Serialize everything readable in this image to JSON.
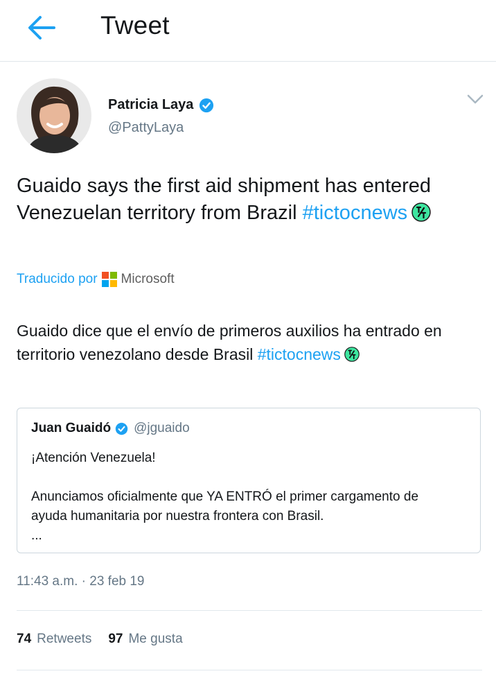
{
  "header": {
    "back_icon": "arrow-left-icon",
    "title": "Tweet"
  },
  "colors": {
    "accent": "#1da1f2",
    "secondary_text": "#657786",
    "primary_text": "#14171a",
    "divider": "#e1e8ed"
  },
  "tweet": {
    "author_name": "Patricia Laya",
    "author_handle": "@PattyLaya",
    "verified_icon": "verified-badge-icon",
    "menu_icon": "chevron-down-icon",
    "text": "Guaido says the first aid shipment has entered Venezuelan territory from Brazil",
    "hashtag": "#tictocnews",
    "emoji_icon": "tictoc-emoji-icon",
    "translated_by_label": "Traducido por",
    "translator_name": "Microsoft",
    "translator_icon": "microsoft-logo-icon",
    "translation_text": "Guaido dice que el envío de primeros auxilios ha entrado en territorio venezolano desde Brasil",
    "translation_hashtag": "#tictocnews",
    "timestamp": "11:43 a.m. · 23 feb 19",
    "retweets_count": "74",
    "retweets_label": "Retweets",
    "likes_count": "97",
    "likes_label": "Me gusta"
  },
  "quoted_tweet": {
    "author_name": "Juan Guaidó",
    "author_handle": "@jguaido",
    "lines": [
      "¡Atención Venezuela!",
      "Anunciamos oficialmente que YA ENTRÓ el primer cargamento de",
      "ayuda humanitaria por nuestra frontera con Brasil.",
      "..."
    ]
  }
}
